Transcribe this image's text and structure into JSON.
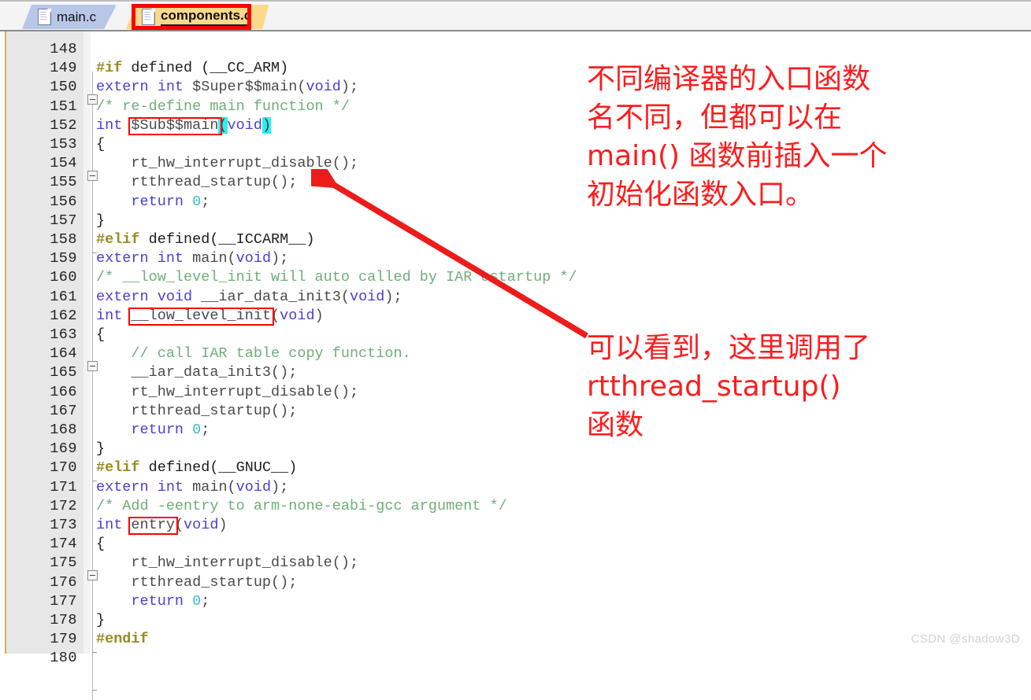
{
  "window": {
    "app": "code-editor",
    "watermark": "CSDN @shadow3D"
  },
  "tabs": [
    {
      "label": "main.c",
      "active": false,
      "icon": "document-icon"
    },
    {
      "label": "components.c",
      "active": true,
      "icon": "document-icon"
    }
  ],
  "editor": {
    "first_line": 148,
    "last_line": 180,
    "language": "c",
    "lines": [
      {
        "n": 148,
        "tokens": []
      },
      {
        "n": 149,
        "fold": "open",
        "tokens": [
          {
            "t": "#if",
            "c": "pre"
          },
          {
            "t": " defined (__CC_ARM)",
            "c": "plain"
          }
        ]
      },
      {
        "n": 150,
        "tokens": [
          {
            "t": "extern int",
            "c": "kw"
          },
          {
            "t": " $Super$$main(",
            "c": "id"
          },
          {
            "t": "void",
            "c": "kw"
          },
          {
            "t": ");",
            "c": "id"
          }
        ]
      },
      {
        "n": 151,
        "tokens": [
          {
            "t": "/* re-define main function */",
            "c": "cmt"
          }
        ]
      },
      {
        "n": 152,
        "tokens": [
          {
            "t": "int",
            "c": "kw"
          },
          {
            "t": " $Sub$$main",
            "c": "id"
          },
          {
            "t": "(",
            "c": "hl"
          },
          {
            "t": "void",
            "c": "kw"
          },
          {
            "t": ")",
            "c": "hl"
          }
        ]
      },
      {
        "n": 153,
        "fold": "open",
        "tokens": [
          {
            "t": "{",
            "c": "plain"
          }
        ]
      },
      {
        "n": 154,
        "tokens": [
          {
            "t": "    rt_hw_interrupt_disable();",
            "c": "id"
          }
        ]
      },
      {
        "n": 155,
        "tokens": [
          {
            "t": "    rtthread_startup();",
            "c": "id"
          }
        ]
      },
      {
        "n": 156,
        "tokens": [
          {
            "t": "    return",
            "c": "kw"
          },
          {
            "t": " ",
            "c": "id"
          },
          {
            "t": "0",
            "c": "num"
          },
          {
            "t": ";",
            "c": "id"
          }
        ]
      },
      {
        "n": 157,
        "fold": "close",
        "tokens": [
          {
            "t": "}",
            "c": "plain"
          }
        ]
      },
      {
        "n": 158,
        "tokens": [
          {
            "t": "#elif",
            "c": "pre"
          },
          {
            "t": " defined(__ICCARM__)",
            "c": "plain"
          }
        ]
      },
      {
        "n": 159,
        "tokens": [
          {
            "t": "extern int",
            "c": "kw"
          },
          {
            "t": " main(",
            "c": "id"
          },
          {
            "t": "void",
            "c": "kw"
          },
          {
            "t": ");",
            "c": "id"
          }
        ]
      },
      {
        "n": 160,
        "tokens": [
          {
            "t": "/* __low_level_init will auto called by IAR cstartup */",
            "c": "cmt"
          }
        ]
      },
      {
        "n": 161,
        "tokens": [
          {
            "t": "extern void",
            "c": "kw"
          },
          {
            "t": " __iar_data_init3(",
            "c": "id"
          },
          {
            "t": "void",
            "c": "kw"
          },
          {
            "t": ");",
            "c": "id"
          }
        ]
      },
      {
        "n": 162,
        "tokens": [
          {
            "t": "int",
            "c": "kw"
          },
          {
            "t": " __low_level_init",
            "c": "id"
          },
          {
            "t": "(",
            "c": "id"
          },
          {
            "t": "void",
            "c": "kw"
          },
          {
            "t": ")",
            "c": "id"
          }
        ]
      },
      {
        "n": 163,
        "fold": "open",
        "tokens": [
          {
            "t": "{",
            "c": "plain"
          }
        ]
      },
      {
        "n": 164,
        "tokens": [
          {
            "t": "    // call IAR table copy function.",
            "c": "cmt"
          }
        ]
      },
      {
        "n": 165,
        "tokens": [
          {
            "t": "    __iar_data_init3();",
            "c": "id"
          }
        ]
      },
      {
        "n": 166,
        "tokens": [
          {
            "t": "    rt_hw_interrupt_disable();",
            "c": "id"
          }
        ]
      },
      {
        "n": 167,
        "tokens": [
          {
            "t": "    rtthread_startup();",
            "c": "id"
          }
        ]
      },
      {
        "n": 168,
        "tokens": [
          {
            "t": "    return",
            "c": "kw"
          },
          {
            "t": " ",
            "c": "id"
          },
          {
            "t": "0",
            "c": "num"
          },
          {
            "t": ";",
            "c": "id"
          }
        ]
      },
      {
        "n": 169,
        "fold": "close",
        "tokens": [
          {
            "t": "}",
            "c": "plain"
          }
        ]
      },
      {
        "n": 170,
        "tokens": [
          {
            "t": "#elif",
            "c": "pre"
          },
          {
            "t": " defined(__GNUC__)",
            "c": "plain"
          }
        ]
      },
      {
        "n": 171,
        "tokens": [
          {
            "t": "extern int",
            "c": "kw"
          },
          {
            "t": " main(",
            "c": "id"
          },
          {
            "t": "void",
            "c": "kw"
          },
          {
            "t": ");",
            "c": "id"
          }
        ]
      },
      {
        "n": 172,
        "tokens": [
          {
            "t": "/* Add -eentry to arm-none-eabi-gcc argument */",
            "c": "cmt"
          }
        ]
      },
      {
        "n": 173,
        "tokens": [
          {
            "t": "int",
            "c": "kw"
          },
          {
            "t": " entry",
            "c": "id"
          },
          {
            "t": "(",
            "c": "id"
          },
          {
            "t": "void",
            "c": "kw"
          },
          {
            "t": ")",
            "c": "id"
          }
        ]
      },
      {
        "n": 174,
        "fold": "open",
        "tokens": [
          {
            "t": "{",
            "c": "plain"
          }
        ]
      },
      {
        "n": 175,
        "tokens": [
          {
            "t": "    rt_hw_interrupt_disable();",
            "c": "id"
          }
        ]
      },
      {
        "n": 176,
        "tokens": [
          {
            "t": "    rtthread_startup();",
            "c": "id"
          }
        ]
      },
      {
        "n": 177,
        "tokens": [
          {
            "t": "    return",
            "c": "kw"
          },
          {
            "t": " ",
            "c": "id"
          },
          {
            "t": "0",
            "c": "num"
          },
          {
            "t": ";",
            "c": "id"
          }
        ]
      },
      {
        "n": 178,
        "fold": "close",
        "tokens": [
          {
            "t": "}",
            "c": "plain"
          }
        ]
      },
      {
        "n": 179,
        "tokens": [
          {
            "t": "#endif",
            "c": "pre"
          }
        ]
      },
      {
        "n": 180,
        "fold": "close",
        "tokens": []
      }
    ]
  },
  "annotations": {
    "boxes": [
      {
        "name": "sub-main-symbol-box",
        "line": 152,
        "label": "$Sub$$main"
      },
      {
        "name": "low-level-init-symbol-box",
        "line": 162,
        "label": "__low_level_init"
      },
      {
        "name": "entry-symbol-box",
        "line": 173,
        "label": "entry"
      },
      {
        "name": "active-tab-box",
        "label": "components.c"
      }
    ],
    "notes": [
      {
        "name": "entry-function-note",
        "text": "不同编译器的入口函数\n名不同，但都可以在\nmain() 函数前插入一个\n初始化函数入口。"
      },
      {
        "name": "rtthread-startup-note",
        "text": "可以看到，这里调用了\nrtthread_startup()\n函数"
      }
    ],
    "arrow": {
      "name": "callout-arrow",
      "from": "rtthread-startup-note",
      "to_line": 155
    },
    "color": "#fe1c1c"
  }
}
